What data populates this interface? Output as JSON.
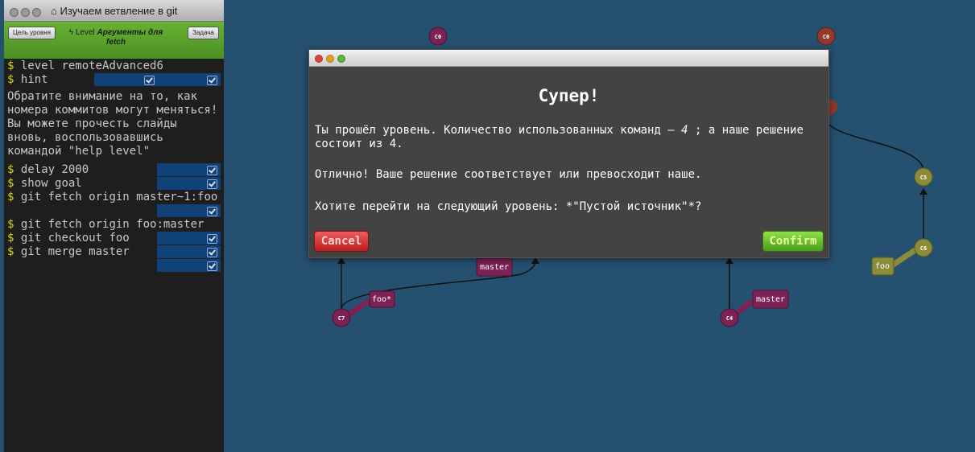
{
  "window": {
    "title": "Изучаем ветвление в git",
    "home_icon": "home-icon"
  },
  "level_bar": {
    "goal_button": "Цель уровня",
    "prefix": "Level",
    "level_name": "Аргументы для fetch",
    "task_button": "Задача"
  },
  "terminal": {
    "prompt": "$",
    "commands": [
      {
        "text": "level remoteAdvanced6",
        "status": false
      },
      {
        "text": "hint",
        "status": true
      },
      {
        "text": "delay 2000",
        "status": true
      },
      {
        "text": "show goal",
        "status": true
      },
      {
        "text": "git fetch origin master~1:foo",
        "status": true
      },
      {
        "text": "git fetch origin foo:master",
        "status": false
      },
      {
        "text": "git checkout foo",
        "status": true
      },
      {
        "text": "git merge master",
        "status": true
      }
    ],
    "hint_text": "Обратите внимание на то, как номера коммитов могут меняться! Вы можете прочесть слайды вновь, воспользовавшись командой \"help level\""
  },
  "graph": {
    "commits": [
      "C0",
      "C0",
      "C7",
      "C4",
      "C5",
      "C6"
    ],
    "branches": [
      "master",
      "foo*",
      "master",
      "foo"
    ]
  },
  "modal": {
    "title": "Супер!",
    "line1_a": "Ты прошёл уровень. Количество использованных команд – ",
    "line1_count": "4",
    "line1_b": " ; а наше решение состоит из 4.",
    "line2": "Отлично! Ваше решение соответствует или превосходит наше.",
    "line3": "Хотите перейти на следующий уровень: *\"Пустой источник\"*?",
    "cancel_label": "Cancel",
    "confirm_label": "Confirm"
  },
  "colors": {
    "background": "#26506f",
    "commit": "#7d2254",
    "remote_commit": "#8f3a2a",
    "ghost_commit": "#8a8c3a",
    "cancel": "#d93535",
    "confirm": "#6cc233"
  }
}
